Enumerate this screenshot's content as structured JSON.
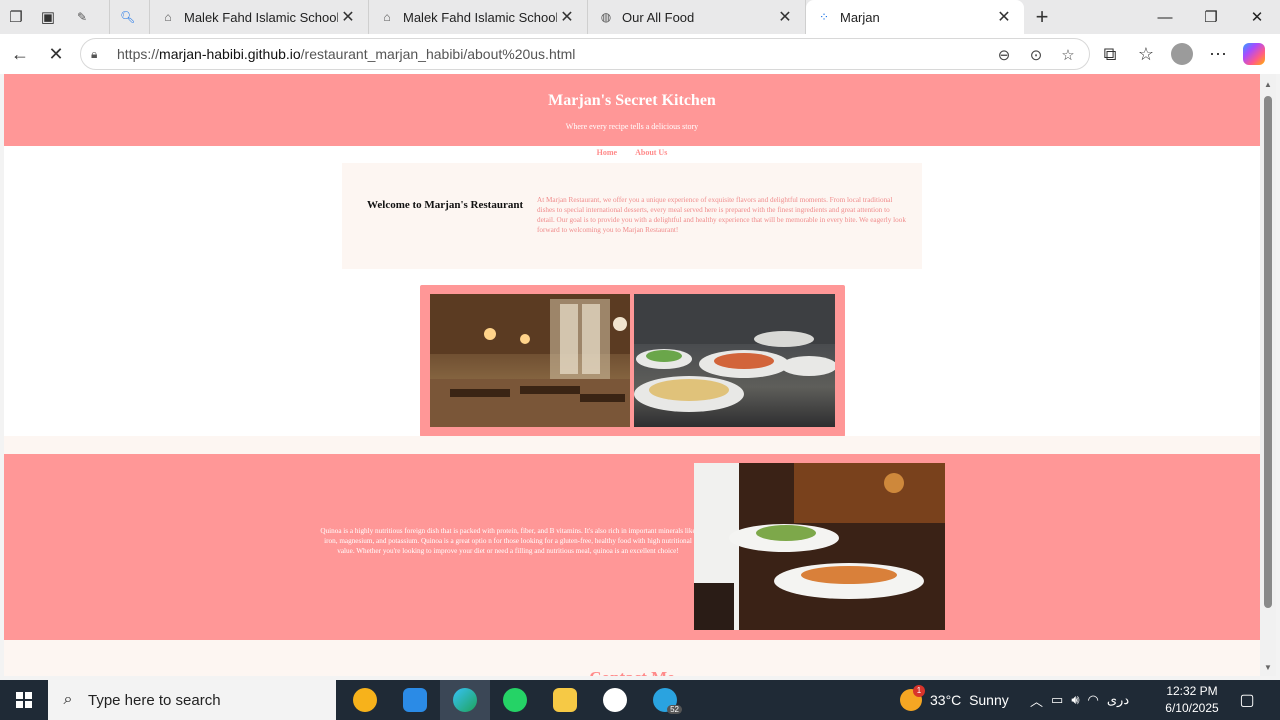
{
  "browser": {
    "tabs": [
      {
        "label": "",
        "icon": "puzzle-icon"
      },
      {
        "label": "",
        "icon": "search-icon"
      },
      {
        "label": "Malek Fahd Islamic School",
        "icon": "school-icon"
      },
      {
        "label": "Malek Fahd Islamic School Enr",
        "icon": "school-icon"
      },
      {
        "label": "Our All Food",
        "icon": "globe-icon"
      },
      {
        "label": "Marjan",
        "icon": "loading-icon",
        "active": true
      }
    ],
    "url_prefix": "https://",
    "url_host": "marjan-habibi.github.io",
    "url_path": "/restaurant_marjan_habibi/about%20us.html"
  },
  "site": {
    "title": "Marjan's Secret Kitchen",
    "tagline": "Where every recipe tells a delicious story",
    "nav": {
      "home": "Home",
      "about": "About Us"
    },
    "welcome_heading": "Welcome to Marjan's Restaurant",
    "welcome_text": "At Marjan Restaurant, we offer you a unique experience of exquisite flavors and delightful moments. From local traditional dishes to special international desserts, every meal served here is prepared with the finest ingredients and great attention to detail. Our goal is to provide you with a delightful and healthy experience that will be memorable in every bite. We eagerly look forward to welcoming you to Marjan Restaurant!",
    "quinoa_text": "Quinoa is a highly nutritious foreign dish that is packed with protein, fiber, and B vitamins. It's also rich in important minerals like iron, magnesium, and potassium. Quinoa is a great optio n for those looking for a gluten-free, healthy food with high nutritional value. Whether you're looking to improve your diet or need a filling and nutritious meal, quinoa is an excellent choice!",
    "contact_heading": "Contact Me",
    "colors": {
      "header_bg": "#ff9797",
      "cream": "#fdf6f2",
      "accent_text": "#ff8a8a"
    }
  },
  "taskbar": {
    "search_placeholder": "Type here to search",
    "weather_badge": "1",
    "temperature": "33°C",
    "condition": "Sunny",
    "language": "دری",
    "time": "12:32 PM",
    "date": "6/10/2025",
    "telegram_badge": "52"
  }
}
